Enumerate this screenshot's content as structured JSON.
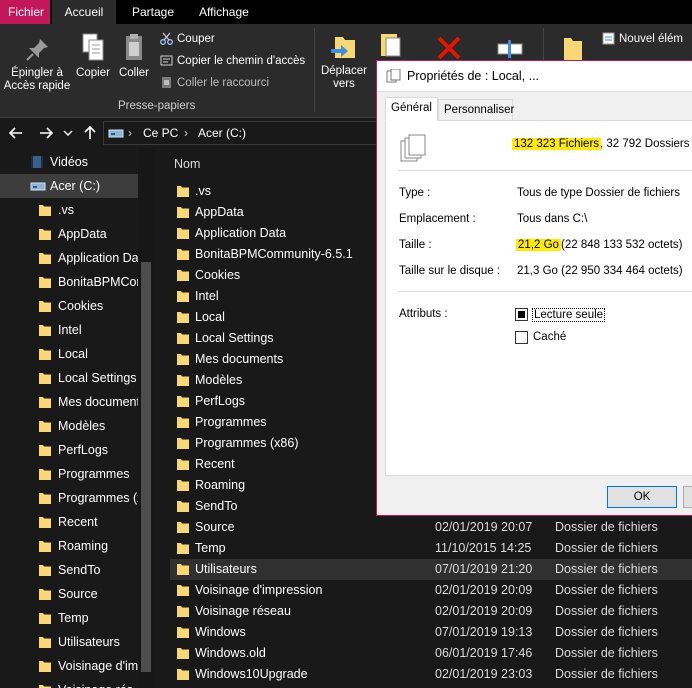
{
  "ribbon_tabs": [
    "Fichier",
    "Accueil",
    "Partage",
    "Affichage"
  ],
  "ribbon": {
    "pin_line1": "Épingler à",
    "pin_line2": "Accès rapide",
    "copy": "Copier",
    "paste": "Coller",
    "cut": "Couper",
    "copy_path": "Copier le chemin d'accès",
    "paste_shortcut": "Coller le raccourci",
    "group_label": "Presse-papiers",
    "move_line1": "Déplacer",
    "move_line2": "vers",
    "new_element": "Nouvel élém",
    "easy_access": "Accès rapide"
  },
  "address": {
    "crumbs": [
      "Ce PC",
      "Acer (C:)"
    ]
  },
  "nav": {
    "videos": "Vidéos",
    "drive": "Acer (C:)",
    "folders": [
      ".vs",
      "AppData",
      "Application Da",
      "BonitaBPMCor",
      "Cookies",
      "Intel",
      "Local",
      "Local Settings",
      "Mes document",
      "Modèles",
      "PerfLogs",
      "Programmes",
      "Programmes (x",
      "Recent",
      "Roaming",
      "SendTo",
      "Source",
      "Temp",
      "Utilisateurs",
      "Voisinage d'im",
      "Voisinage rés"
    ]
  },
  "list": {
    "column_name": "Nom",
    "rows": [
      {
        "name": ".vs",
        "date": "",
        "type": ""
      },
      {
        "name": "AppData",
        "date": "",
        "type": ""
      },
      {
        "name": "Application Data",
        "date": "",
        "type": ""
      },
      {
        "name": "BonitaBPMCommunity-6.5.1",
        "date": "",
        "type": ""
      },
      {
        "name": "Cookies",
        "date": "",
        "type": ""
      },
      {
        "name": "Intel",
        "date": "",
        "type": ""
      },
      {
        "name": "Local",
        "date": "",
        "type": ""
      },
      {
        "name": "Local Settings",
        "date": "",
        "type": ""
      },
      {
        "name": "Mes documents",
        "date": "",
        "type": ""
      },
      {
        "name": "Modèles",
        "date": "",
        "type": ""
      },
      {
        "name": "PerfLogs",
        "date": "",
        "type": ""
      },
      {
        "name": "Programmes",
        "date": "",
        "type": ""
      },
      {
        "name": "Programmes (x86)",
        "date": "",
        "type": ""
      },
      {
        "name": "Recent",
        "date": "",
        "type": ""
      },
      {
        "name": "Roaming",
        "date": "",
        "type": ""
      },
      {
        "name": "SendTo",
        "date": "",
        "type": ""
      },
      {
        "name": "Source",
        "date": "02/01/2019 20:07",
        "type": "Dossier de fichiers"
      },
      {
        "name": "Temp",
        "date": "11/10/2015 14:25",
        "type": "Dossier de fichiers"
      },
      {
        "name": "Utilisateurs",
        "date": "07/01/2019 21:20",
        "type": "Dossier de fichiers"
      },
      {
        "name": "Voisinage d'impression",
        "date": "02/01/2019 20:09",
        "type": "Dossier de fichiers"
      },
      {
        "name": "Voisinage réseau",
        "date": "02/01/2019 20:09",
        "type": "Dossier de fichiers"
      },
      {
        "name": "Windows",
        "date": "07/01/2019 19:13",
        "type": "Dossier de fichiers"
      },
      {
        "name": "Windows.old",
        "date": "06/01/2019 17:46",
        "type": "Dossier de fichiers"
      },
      {
        "name": "Windows10Upgrade",
        "date": "02/01/2019 23:03",
        "type": "Dossier de fichiers"
      }
    ]
  },
  "dialog": {
    "title": "Propriétés de : Local, ...",
    "tab_general": "Général",
    "tab_custom": "Personnaliser",
    "files_count": "132 323 Fichiers",
    "folders_count": ", 32 792 Dossiers",
    "type_label": "Type :",
    "type_value": "Tous de type Dossier de fichiers",
    "location_label": "Emplacement :",
    "location_value": "Tous dans C:\\",
    "size_label": "Taille :",
    "size_value": "21,2 Go",
    "size_bytes": "(22 848 133 532 octets)",
    "disk_size_label": "Taille sur le disque :",
    "disk_size_value": "21,3 Go (22 950 334 464 octets)",
    "attributes_label": "Attributs :",
    "readonly_label": "Lecture seule",
    "hidden_label": "Caché",
    "ok_label": "OK"
  },
  "colors": {
    "accent": "#c2185b",
    "highlight": "#ffea00",
    "folder": "#f8d775",
    "background": "#191919"
  }
}
